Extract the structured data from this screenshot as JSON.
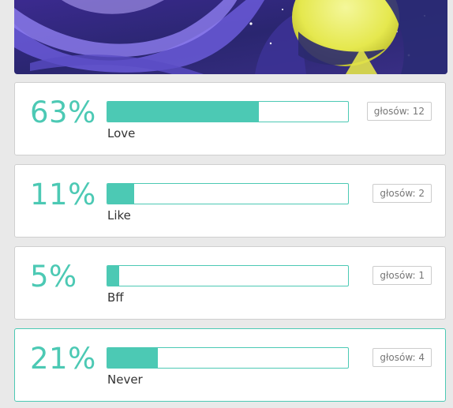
{
  "colors": {
    "accent": "#4cc9b4",
    "card_border": "#cfcfcf",
    "page_background": "#e9e9e9",
    "label_text": "#333333",
    "badge_text": "#777777"
  },
  "banner": {
    "icon": "decorative-artwork-image"
  },
  "poll": {
    "options": [
      {
        "percent_text": "63%",
        "fill_fraction": 0.63,
        "label": "Love",
        "votes": "głosów: 12",
        "selected": false
      },
      {
        "percent_text": "11%",
        "fill_fraction": 0.11,
        "label": "Like",
        "votes": "głosów: 2",
        "selected": false
      },
      {
        "percent_text": "5%",
        "fill_fraction": 0.05,
        "label": "Bff",
        "votes": "głosów: 1",
        "selected": false
      },
      {
        "percent_text": "21%",
        "fill_fraction": 0.21,
        "label": "Never",
        "votes": "głosów: 4",
        "selected": true
      }
    ]
  }
}
